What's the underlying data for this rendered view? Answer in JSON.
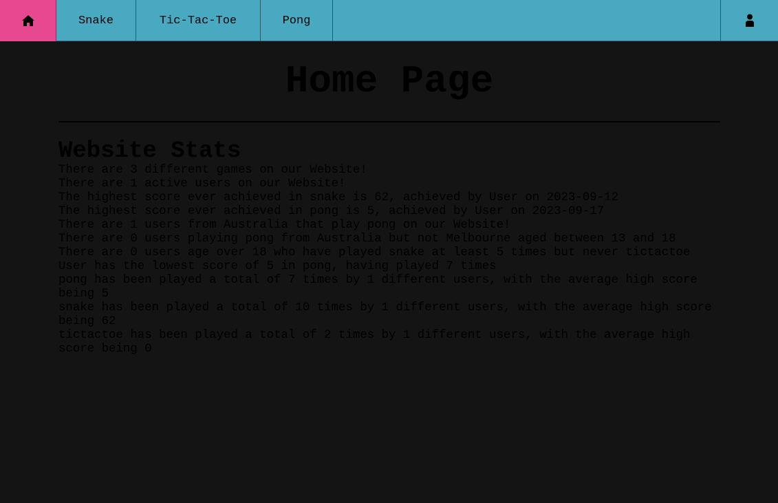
{
  "nav": {
    "home_icon": "home-icon",
    "user_icon": "user-icon",
    "items": [
      {
        "label": "Snake"
      },
      {
        "label": "Tic-Tac-Toe"
      },
      {
        "label": "Pong"
      }
    ]
  },
  "colors": {
    "navbar": "#49a9c1",
    "home_tab": "#e8488f",
    "background": "#141414"
  },
  "main": {
    "title": "Home Page",
    "section_title": "Website Stats",
    "stats": [
      "There are 3 different games on our Website!",
      "There are 1 active users on our Website!",
      "The highest score ever achieved in snake is 62, achieved by User on 2023-09-12",
      "The highest score ever achieved in pong is 5, achieved by User on 2023-09-17",
      "There are 1 users from Australia that play pong on our Website!",
      "There are 0 users playing pong from Australia but not Melbourne aged between 13 and 18",
      "There are 0 users age over 18 who have played snake at least 5 times but never tictactoe",
      "User has the lowest score of 5 in pong, having played 7 times",
      "pong has been played a total of 7 times by 1 different users, with the average high score being 5",
      "snake has been played a total of 10 times by 1 different users, with the average high score being 62",
      "tictactoe has been played a total of 2 times by 1 different users, with the average high score being 0"
    ]
  }
}
